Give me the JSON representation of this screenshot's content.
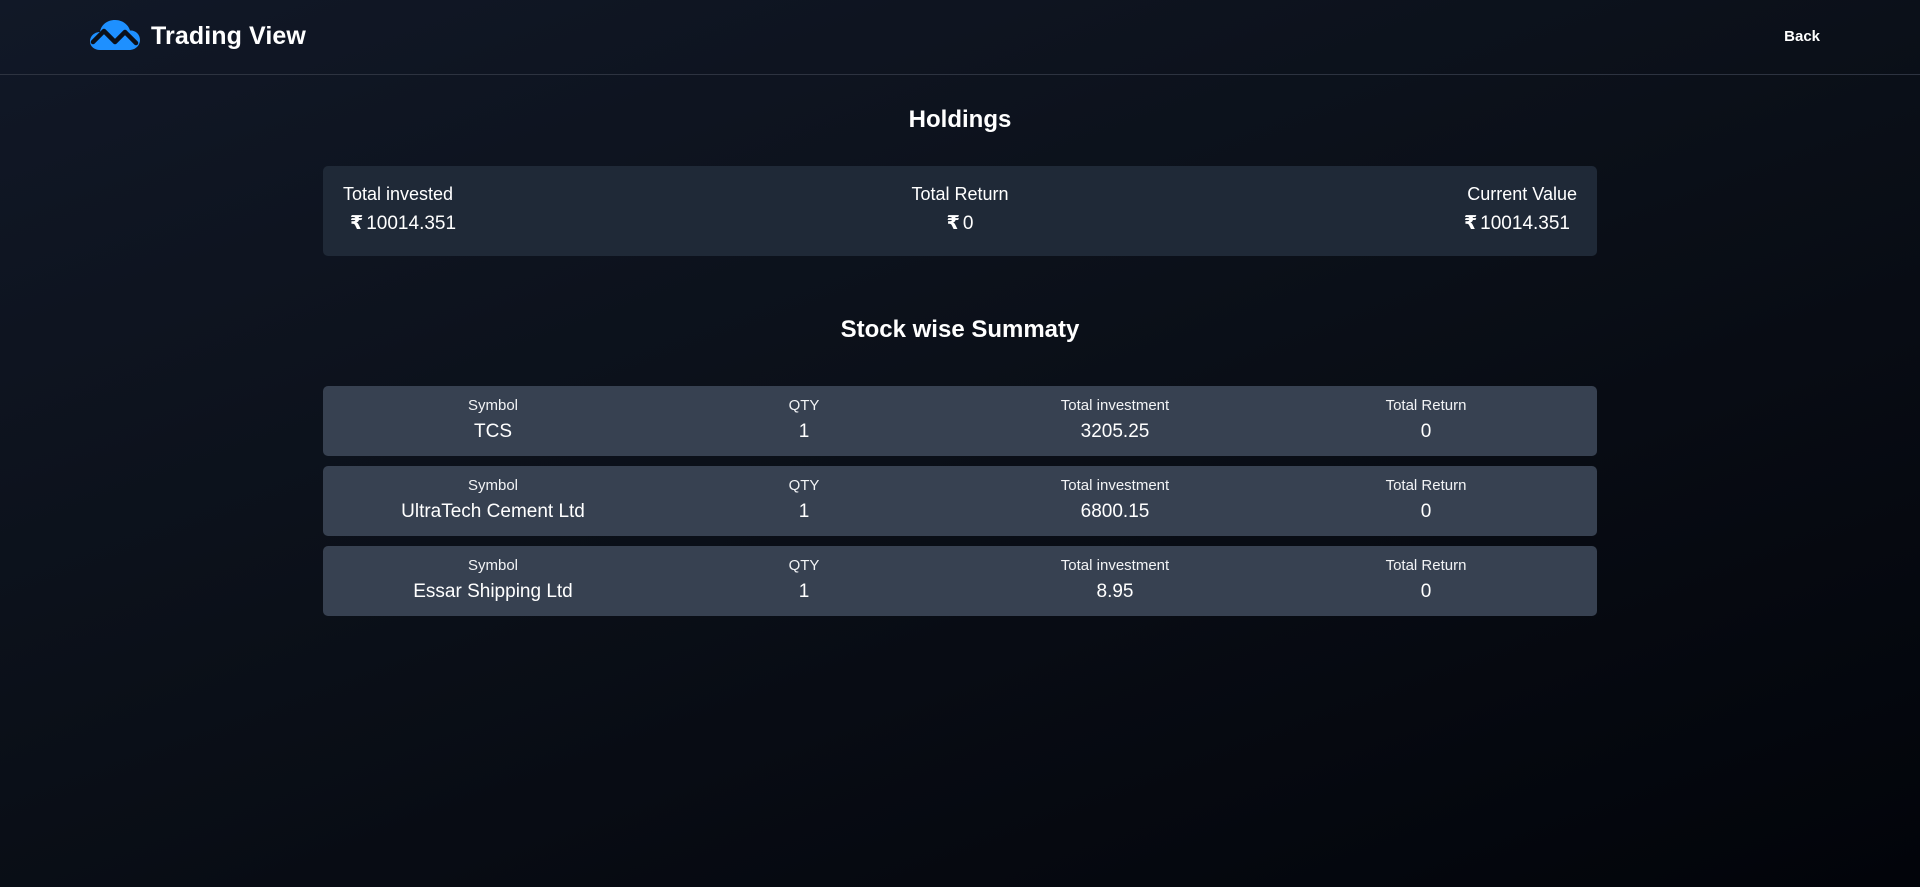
{
  "header": {
    "brand": "Trading View",
    "back_label": "Back",
    "logo_icon": "cloud-chart-icon",
    "accent_color": "#1e90ff"
  },
  "holdings": {
    "title": "Holdings",
    "currency_symbol": "₹",
    "total_invested_label": "Total invested",
    "total_invested_value": "10014.351",
    "total_return_label": "Total Return",
    "total_return_value": "0",
    "current_value_label": "Current Value",
    "current_value_value": "10014.351"
  },
  "summary": {
    "title": "Stock wise Summaty",
    "columns": {
      "symbol": "Symbol",
      "qty": "QTY",
      "investment": "Total investment",
      "return": "Total Return"
    },
    "rows": [
      {
        "symbol": "TCS",
        "qty": "1",
        "investment": "3205.25",
        "return": "0"
      },
      {
        "symbol": "UltraTech Cement Ltd",
        "qty": "1",
        "investment": "6800.15",
        "return": "0"
      },
      {
        "symbol": "Essar Shipping Ltd",
        "qty": "1",
        "investment": "8.95",
        "return": "0"
      }
    ]
  }
}
